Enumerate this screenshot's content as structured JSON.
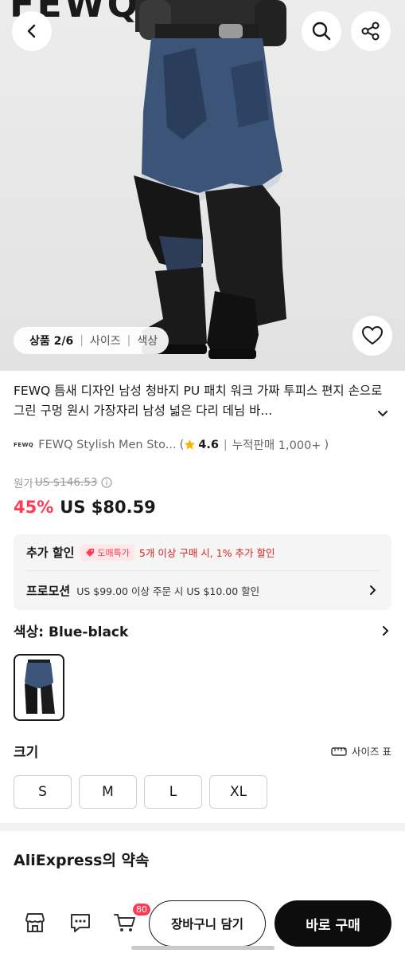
{
  "hero": {
    "brand_text": "FEWQ",
    "pager": {
      "current": "상품 2/6",
      "tab_size": "사이즈",
      "tab_color": "색상"
    }
  },
  "product": {
    "title": "FEWQ 틈새 디자인 남성 청바지 PU 패치 워크 가짜 투피스 편지 손으로 그린 구멍 원시 가장자리 남성 넓은 다리 데님 바..."
  },
  "store": {
    "logo_text": "FEWQ",
    "name": "FEWQ Stylish Men Sto...",
    "rating": "4.6",
    "sales": "누적판매 1,000+",
    "open_paren": "(",
    "close_paren": ")",
    "divider": "|"
  },
  "price": {
    "original_label": "원가",
    "original_value": "US $146.53",
    "discount": "45%",
    "current": "US $80.59"
  },
  "promo": {
    "extra_label": "추가 할인",
    "badge": "도매특가",
    "extra_text": "5개 이상 구매 시, 1% 추가 할인",
    "promotion_label": "프로모션",
    "promotion_text": "US $99.00 이상 주문 시 US $10.00 할인"
  },
  "color": {
    "label": "색상: Blue-black"
  },
  "size": {
    "label": "크기",
    "chart_label": "사이즈 표",
    "options": [
      "S",
      "M",
      "L",
      "XL"
    ]
  },
  "promise": {
    "title": "AliExpress의 약속"
  },
  "bottom_bar": {
    "cart_count": "80",
    "add_to_cart": "장바구니 담기",
    "buy_now": "바로 구매"
  },
  "colors": {
    "accent_red": "#ff3a52",
    "buy_button": "#0d0d0d",
    "rating_star": "#f5b400"
  },
  "icons": [
    "back-icon",
    "search-icon",
    "share-icon",
    "heart-icon",
    "chevron-down-icon",
    "star-icon",
    "info-icon",
    "chevron-right-icon",
    "size-chart-icon",
    "store-icon",
    "chat-icon",
    "cart-icon"
  ]
}
